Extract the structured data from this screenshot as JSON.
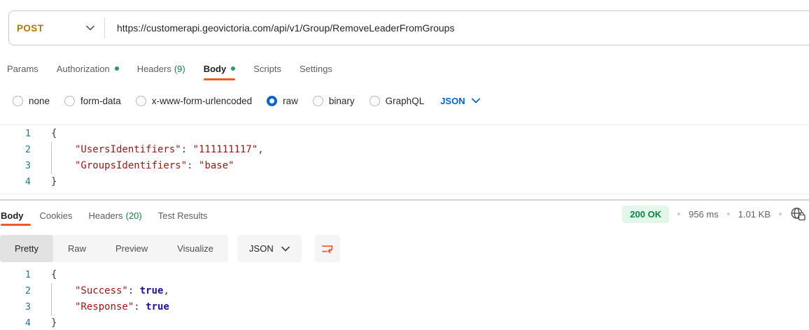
{
  "request": {
    "method": "POST",
    "url": "https://customerapi.geovictoria.com/api/v1/Group/RemoveLeaderFromGroups",
    "tabs": {
      "params": "Params",
      "authorization": "Authorization",
      "headers": "Headers",
      "headers_count": "(9)",
      "body": "Body",
      "scripts": "Scripts",
      "settings": "Settings"
    },
    "active_tab": "Body",
    "body_types": {
      "none": "none",
      "form_data": "form-data",
      "urlencoded": "x-www-form-urlencoded",
      "raw": "raw",
      "binary": "binary",
      "graphql": "GraphQL"
    },
    "selected_body_type": "raw",
    "language": "JSON",
    "code": [
      {
        "n": "1",
        "t": [
          {
            "c": "p",
            "v": "{"
          }
        ]
      },
      {
        "n": "2",
        "g": true,
        "t": [
          {
            "c": "s",
            "v": "\"UsersIdentifiers\""
          },
          {
            "c": "p",
            "v": ": "
          },
          {
            "c": "s",
            "v": "\"111111117\""
          },
          {
            "c": "p",
            "v": ","
          }
        ]
      },
      {
        "n": "3",
        "g": true,
        "t": [
          {
            "c": "s",
            "v": "\"GroupsIdentifiers\""
          },
          {
            "c": "p",
            "v": ": "
          },
          {
            "c": "s",
            "v": "\"base\""
          }
        ]
      },
      {
        "n": "4",
        "t": [
          {
            "c": "p",
            "v": "}"
          }
        ]
      }
    ]
  },
  "response": {
    "tabs": {
      "body": "Body",
      "cookies": "Cookies",
      "headers": "Headers",
      "headers_count": "(20)",
      "test_results": "Test Results"
    },
    "active_tab": "Body",
    "status": "200 OK",
    "time": "956 ms",
    "size": "1.01 KB",
    "views": {
      "pretty": "Pretty",
      "raw": "Raw",
      "preview": "Preview",
      "visualize": "Visualize"
    },
    "active_view": "Pretty",
    "language": "JSON",
    "code": [
      {
        "n": "1",
        "t": [
          {
            "c": "p",
            "v": "{"
          }
        ]
      },
      {
        "n": "2",
        "g": true,
        "t": [
          {
            "c": "s",
            "v": "\"Success\""
          },
          {
            "c": "p",
            "v": ": "
          },
          {
            "c": "b",
            "v": "true"
          },
          {
            "c": "p",
            "v": ","
          }
        ]
      },
      {
        "n": "3",
        "g": true,
        "t": [
          {
            "c": "s",
            "v": "\"Response\""
          },
          {
            "c": "p",
            "v": ": "
          },
          {
            "c": "b",
            "v": "true"
          }
        ]
      },
      {
        "n": "4",
        "t": [
          {
            "c": "p",
            "v": "}"
          }
        ]
      }
    ]
  },
  "icons": {
    "method_dropdown": "chevron-down-icon",
    "language_dropdown": "chevron-down-icon",
    "network": "globe-lock-icon",
    "wrap": "wrap-text-icon"
  },
  "colors": {
    "accent_orange": "#ef5b25",
    "method_post": "#ad7a03",
    "link_blue": "#0265d2",
    "success_green": "#0e8345",
    "status_pill_bg": "#e2f6ea",
    "line_number_blue": "#237893",
    "string_red": "#a31515",
    "boolean_blue": "#221199"
  }
}
